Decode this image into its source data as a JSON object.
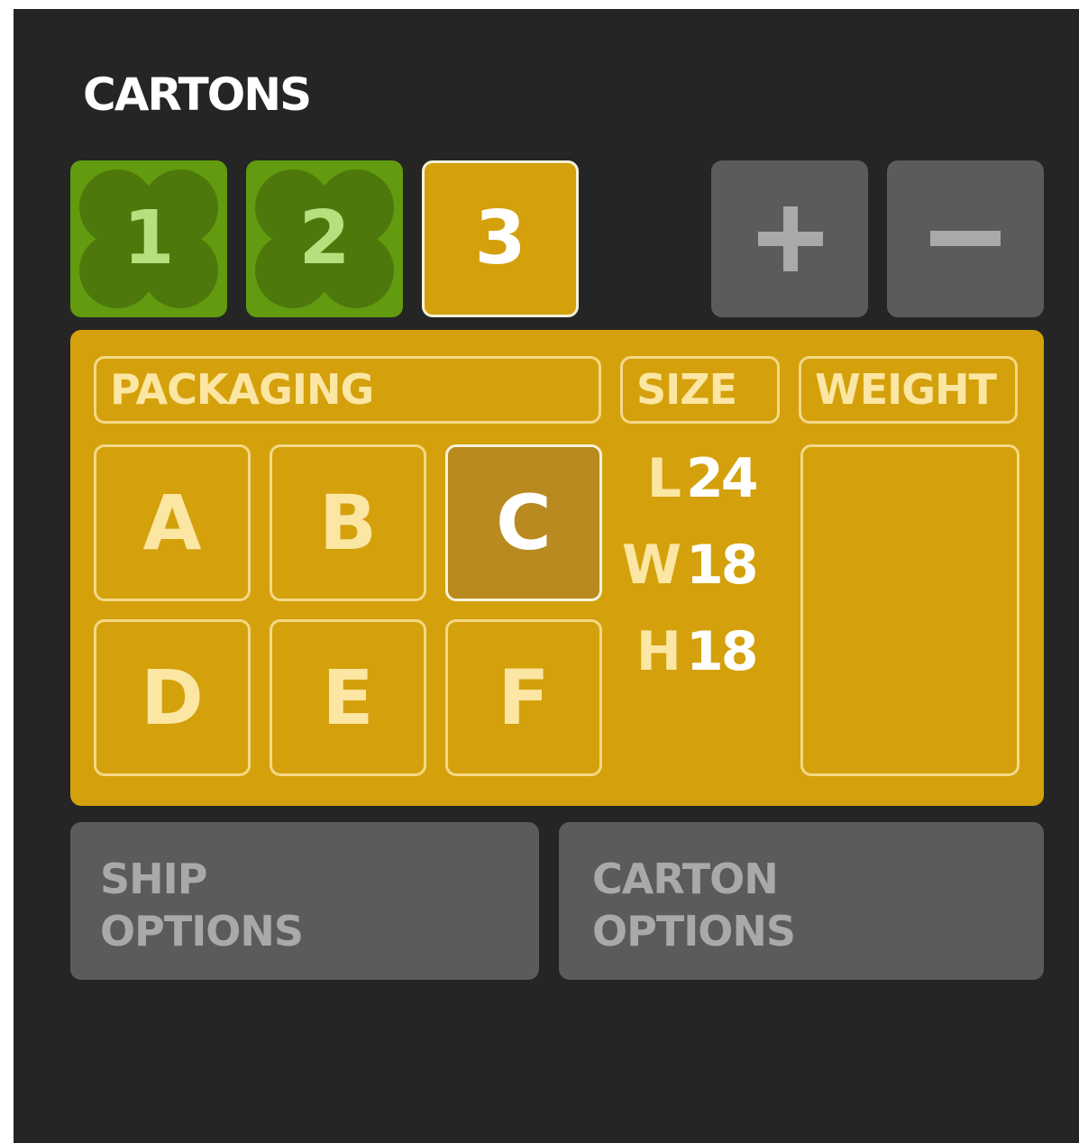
{
  "header": {
    "title": "CARTONS"
  },
  "cartons": {
    "tabs": [
      {
        "label": "1",
        "state": "complete"
      },
      {
        "label": "2",
        "state": "complete"
      },
      {
        "label": "3",
        "state": "active"
      }
    ],
    "add_icon": "plus-icon",
    "remove_icon": "minus-icon"
  },
  "details": {
    "packaging_label": "PACKAGING",
    "size_label": "SIZE",
    "weight_label": "WEIGHT",
    "packaging_options": [
      "A",
      "B",
      "C",
      "D",
      "E",
      "F"
    ],
    "selected_packaging": "C",
    "size": {
      "length_label": "L",
      "length": "24",
      "width_label": "W",
      "width": "18",
      "height_label": "H",
      "height": "18"
    },
    "weight_value": ""
  },
  "options": {
    "ship_line1": "SHIP",
    "ship_line2": "OPTIONS",
    "carton_line1": "CARTON",
    "carton_line2": "OPTIONS"
  },
  "colors": {
    "background": "#252525",
    "accent_gold": "#d4a10c",
    "complete_green": "#629b0f",
    "button_gray": "#5b5b5b"
  }
}
